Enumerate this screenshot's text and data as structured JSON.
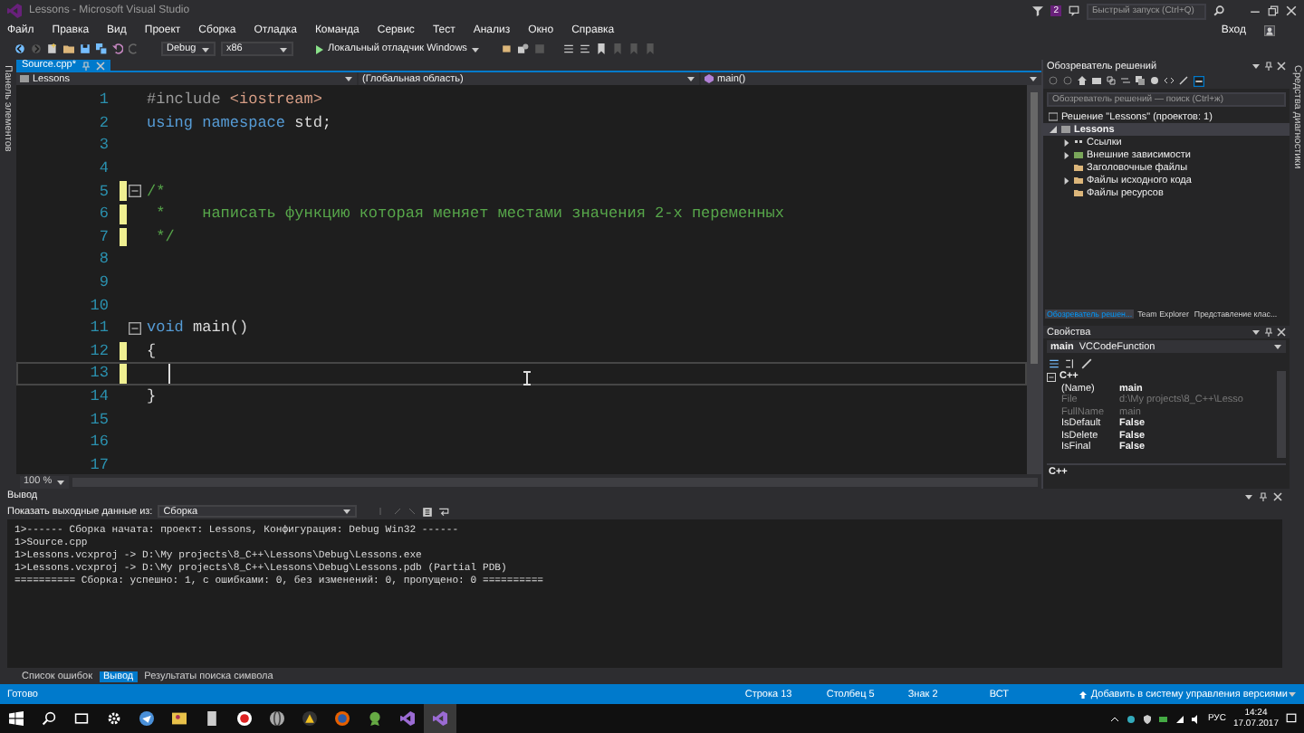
{
  "window": {
    "title": "Lessons - Microsoft Visual Studio",
    "notifications": "2",
    "quick_launch": {
      "placeholder": "Быстрый запуск (Ctrl+Q)"
    },
    "sign_in": "Вход"
  },
  "menu": [
    "Файл",
    "Правка",
    "Вид",
    "Проект",
    "Сборка",
    "Отладка",
    "Команда",
    "Сервис",
    "Тест",
    "Анализ",
    "Окно",
    "Справка"
  ],
  "toolbar": {
    "configuration": "Debug",
    "platform": "x86",
    "debugger": "Локальный отладчик Windows"
  },
  "left_strip": "Панель элементов",
  "right_strip": "Средства диагностики",
  "doc_tabs": [
    {
      "label": "Source.cpp*",
      "selected": true
    }
  ],
  "nav_bar": {
    "project": "Lessons",
    "scope": "(Глобальная область)",
    "member": "main()"
  },
  "code": [
    {
      "number": "1",
      "changed": false,
      "current": false,
      "fold": false,
      "tokens": [
        {
          "kind": "pre",
          "text": "#include "
        },
        {
          "kind": "str",
          "text": "<iostream>"
        }
      ]
    },
    {
      "number": "2",
      "changed": false,
      "current": false,
      "fold": false,
      "tokens": [
        {
          "kind": "kw",
          "text": "using namespace "
        },
        {
          "kind": "plain",
          "text": "std;"
        }
      ]
    },
    {
      "number": "3",
      "changed": false,
      "current": false,
      "fold": false
    },
    {
      "number": "4",
      "changed": false,
      "current": false,
      "fold": false
    },
    {
      "number": "5",
      "changed": true,
      "current": false,
      "fold": true,
      "tokens": [
        {
          "kind": "com",
          "text": "/*"
        }
      ]
    },
    {
      "number": "6",
      "changed": true,
      "current": false,
      "fold": false,
      "tokens": [
        {
          "kind": "com",
          "text": " *    написать функцию которая меняет местами значения 2-х переменных"
        }
      ]
    },
    {
      "number": "7",
      "changed": true,
      "current": false,
      "fold": false,
      "tokens": [
        {
          "kind": "com",
          "text": " */"
        }
      ]
    },
    {
      "number": "8",
      "changed": false,
      "current": false,
      "fold": false
    },
    {
      "number": "9",
      "changed": false,
      "current": false,
      "fold": false
    },
    {
      "number": "10",
      "changed": false,
      "current": false,
      "fold": false
    },
    {
      "number": "11",
      "changed": false,
      "current": false,
      "fold": true,
      "tokens": [
        {
          "kind": "kw",
          "text": "void "
        },
        {
          "kind": "plain",
          "text": "main()"
        }
      ]
    },
    {
      "number": "12",
      "changed": true,
      "current": false,
      "fold": false,
      "tokens": [
        {
          "kind": "plain",
          "text": "{"
        }
      ]
    },
    {
      "number": "13",
      "changed": true,
      "current": true,
      "fold": false
    },
    {
      "number": "14",
      "changed": false,
      "current": false,
      "fold": false,
      "tokens": [
        {
          "kind": "plain",
          "text": "}"
        }
      ]
    },
    {
      "number": "15",
      "changed": false,
      "current": false,
      "fold": false
    },
    {
      "number": "16",
      "changed": false,
      "current": false,
      "fold": false
    },
    {
      "number": "17",
      "changed": false,
      "current": false,
      "fold": false
    }
  ],
  "zoom": "100 %",
  "solution_explorer": {
    "title": "Обозреватель решений",
    "search": {
      "placeholder": "Обозреватель решений — поиск (Ctrl+ж)"
    },
    "solution": "Решение \"Lessons\" (проектов: 1)",
    "project": {
      "label": "Lessons",
      "selected": true,
      "children": [
        {
          "label": "Ссылки",
          "kind": "refs",
          "expandable": true
        },
        {
          "label": "Внешние зависимости",
          "kind": "deps",
          "expandable": true
        },
        {
          "label": "Заголовочные файлы",
          "kind": "folder",
          "expandable": false
        },
        {
          "label": "Файлы исходного кода",
          "kind": "folder",
          "expandable": true
        },
        {
          "label": "Файлы ресурсов",
          "kind": "folder",
          "expandable": false
        }
      ]
    }
  },
  "panel_tabs": [
    {
      "label": "Обозреватель решен...",
      "selected": true
    },
    {
      "label": "Team Explorer",
      "selected": false
    },
    {
      "label": "Представление клас...",
      "selected": false
    }
  ],
  "properties": {
    "title": "Свойства",
    "object": "main",
    "type": "VCCodeFunction",
    "category": "C++",
    "rows": [
      {
        "name": "(Name)",
        "value": "main",
        "disabled": false
      },
      {
        "name": "File",
        "value": "d:\\My projects\\8_C++\\Lesso",
        "disabled": true
      },
      {
        "name": "FullName",
        "value": "main",
        "disabled": true
      },
      {
        "name": "IsDefault",
        "value": "False",
        "disabled": false
      },
      {
        "name": "IsDelete",
        "value": "False",
        "disabled": false
      },
      {
        "name": "IsFinal",
        "value": "False",
        "disabled": false
      }
    ],
    "description": "C++"
  },
  "output": {
    "title": "Вывод",
    "source_label": "Показать выходные данные из:",
    "source": "Сборка",
    "lines": [
      "1>------ Сборка начата: проект: Lessons, Конфигурация: Debug Win32 ------",
      "1>Source.cpp",
      "1>Lessons.vcxproj -> D:\\My projects\\8_C++\\Lessons\\Debug\\Lessons.exe",
      "1>Lessons.vcxproj -> D:\\My projects\\8_C++\\Lessons\\Debug\\Lessons.pdb (Partial PDB)",
      "========== Сборка: успешно: 1, с ошибками: 0, без изменений: 0, пропущено: 0 =========="
    ]
  },
  "bottom_tabs": [
    {
      "label": "Список ошибок",
      "selected": false
    },
    {
      "label": "Вывод",
      "selected": true
    },
    {
      "label": "Результаты поиска символа",
      "selected": false
    }
  ],
  "status": {
    "text": "Готово",
    "line": "Строка 13",
    "column": "Столбец 5",
    "char": "Знак 2",
    "mode": "ВСТ",
    "source_control": "Добавить в систему управления версиями"
  },
  "taskbar": {
    "language": "РУС",
    "time": "14:24",
    "date": "17.07.2017"
  }
}
